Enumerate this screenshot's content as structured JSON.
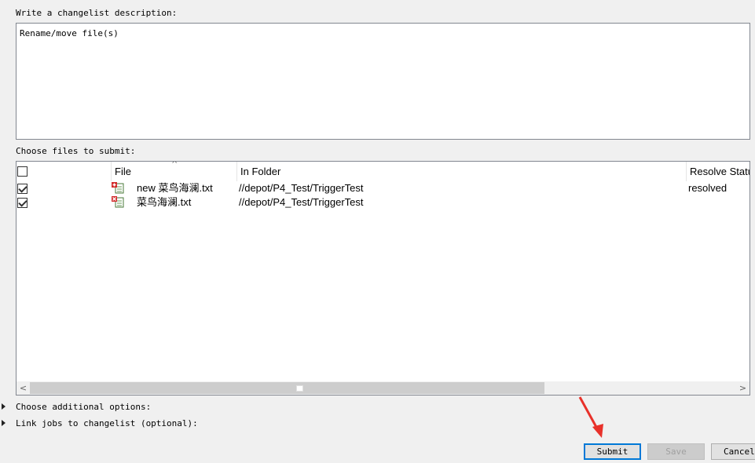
{
  "description_label": "Write a changelist description:",
  "description_text": "Rename/move file(s)",
  "files_label": "Choose files to submit:",
  "columns": {
    "file": "File",
    "in_folder": "In Folder",
    "resolve_status": "Resolve Status"
  },
  "files": [
    {
      "checked": true,
      "name": "new 菜鸟海澜.txt",
      "folder": "//depot/P4_Test/TriggerTest",
      "status": "resolved",
      "icon": "file-move-add-icon"
    },
    {
      "checked": true,
      "name": "菜鸟海澜.txt",
      "folder": "//depot/P4_Test/TriggerTest",
      "status": "",
      "icon": "file-move-delete-icon"
    }
  ],
  "options": {
    "additional": "Choose additional options:",
    "link_jobs": "Link jobs to changelist (optional):"
  },
  "buttons": {
    "submit": "Submit",
    "save": "Save",
    "cancel": "Cancel"
  },
  "colors": {
    "focus_border": "#0078d7",
    "annotation_arrow": "#e8312a"
  }
}
